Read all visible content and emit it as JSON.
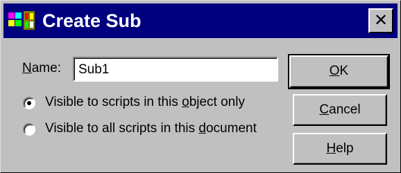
{
  "window": {
    "title": "Create Sub",
    "icon": "vb-app-icon",
    "close_glyph": "✕"
  },
  "form": {
    "name_label": {
      "pre": "",
      "mnemonic": "N",
      "post": "ame:"
    },
    "name_value": "Sub1",
    "radio_object": {
      "checked": true,
      "pre": "Visible to scripts in this ",
      "mnemonic": "o",
      "post": "bject only"
    },
    "radio_document": {
      "checked": false,
      "pre": "Visible to all scripts in this ",
      "mnemonic": "d",
      "post": "ocument"
    }
  },
  "buttons": {
    "ok": {
      "pre": "",
      "mnemonic": "O",
      "post": "K"
    },
    "cancel": {
      "pre": "",
      "mnemonic": "C",
      "post": "ancel"
    },
    "help": {
      "pre": "",
      "mnemonic": "H",
      "post": "elp"
    }
  },
  "colors": {
    "titlebar": "#00007f",
    "face": "#c0c0c0"
  }
}
